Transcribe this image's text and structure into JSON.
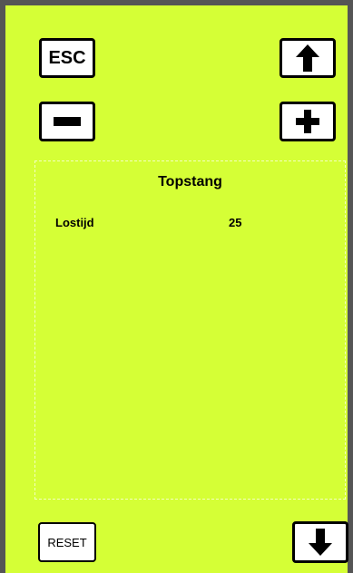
{
  "theme": {
    "background": "#D5FF36",
    "frame": "#555555",
    "button_background": "#FFFFFF",
    "text": "#000000"
  },
  "buttons": {
    "esc_label": "ESC",
    "reset_label": "RESET",
    "up_icon": "arrow-up-icon",
    "down_icon": "arrow-down-icon",
    "minus_icon": "minus-icon",
    "plus_icon": "plus-icon"
  },
  "panel": {
    "title": "Topstang",
    "parameter": {
      "label": "Lostijd",
      "value": "25"
    }
  }
}
